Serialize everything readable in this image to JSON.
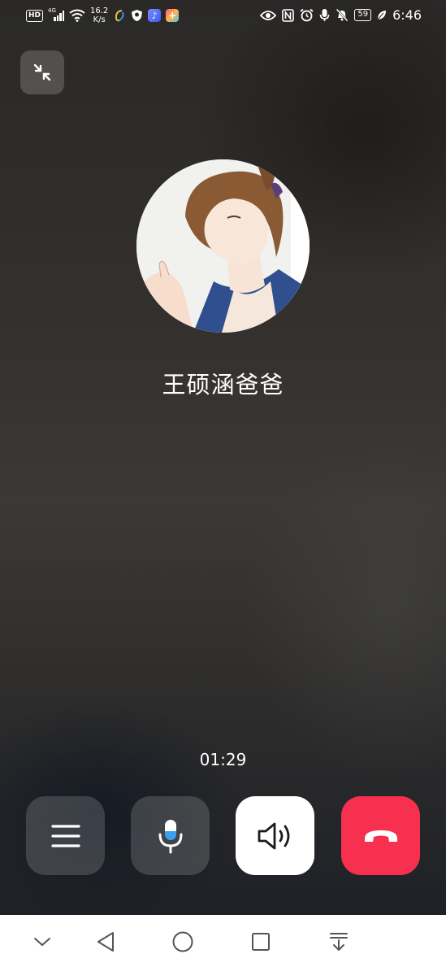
{
  "status_bar": {
    "hd": "HD",
    "network": "4G",
    "speed_value": "16.2",
    "speed_unit": "K/s",
    "battery": "59",
    "time": "6:46"
  },
  "call": {
    "caller_name": "王硕涵爸爸",
    "duration": "01:29"
  },
  "colors": {
    "hangup": "#f6304e",
    "speaker_active": "#ffffff",
    "mic_accent": "#3aa0f0"
  },
  "icons": {
    "minimize": "minimize-icon",
    "menu": "menu-icon",
    "mic": "microphone-icon",
    "speaker": "speaker-icon",
    "hangup": "hang-up-icon"
  }
}
